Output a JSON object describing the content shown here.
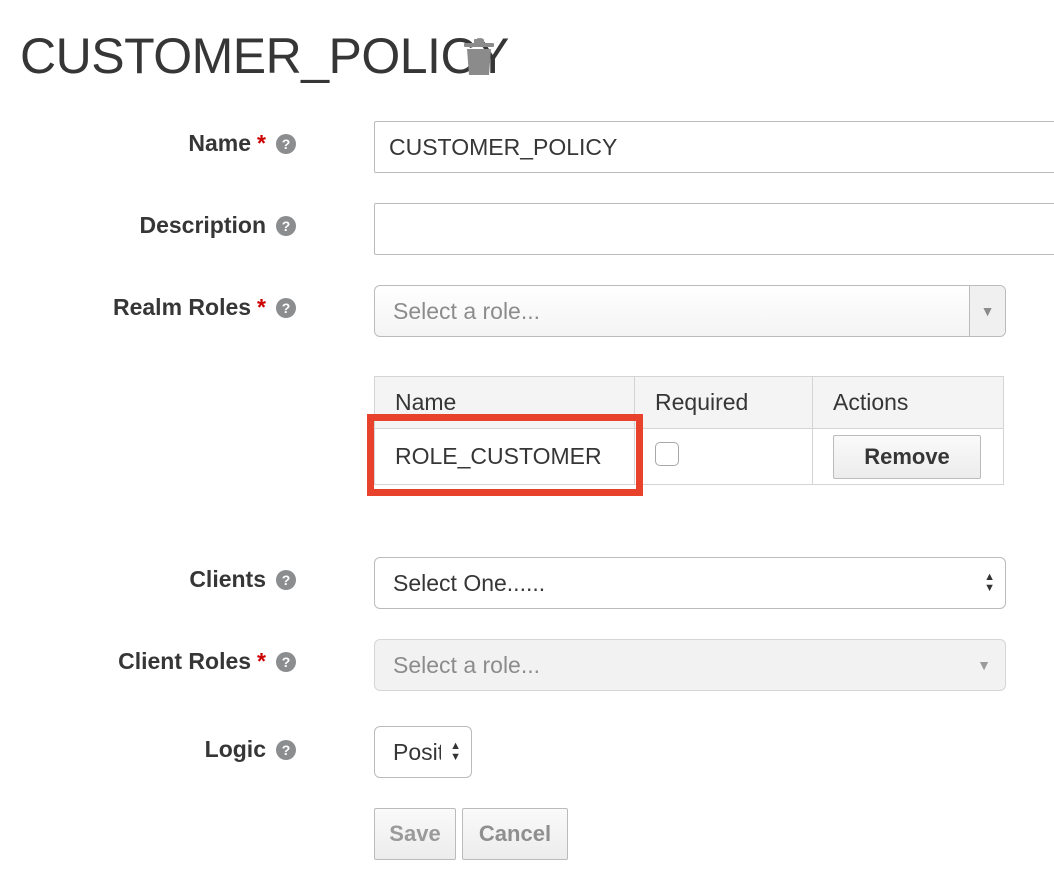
{
  "header": {
    "title": "CUSTOMER_POLICY",
    "delete_icon": "trash-icon"
  },
  "form": {
    "name": {
      "label": "Name",
      "required_mark": "*",
      "value": "CUSTOMER_POLICY"
    },
    "description": {
      "label": "Description",
      "value": ""
    },
    "realm_roles": {
      "label": "Realm Roles",
      "required_mark": "*",
      "placeholder": "Select a role..."
    },
    "roles_table": {
      "columns": [
        "Name",
        "Required",
        "Actions"
      ],
      "rows": [
        {
          "name": "ROLE_CUSTOMER",
          "required": false,
          "action": "Remove"
        }
      ]
    },
    "clients": {
      "label": "Clients",
      "selected": "Select One......"
    },
    "client_roles": {
      "label": "Client Roles",
      "required_mark": "*",
      "placeholder": "Select a role..."
    },
    "logic": {
      "label": "Logic",
      "selected": "Positive",
      "visible_text": "Posit"
    },
    "buttons": {
      "save": "Save",
      "cancel": "Cancel"
    }
  },
  "colors": {
    "highlight": "#e8412c",
    "required": "#cc0000",
    "help_icon": "#8b8d8f"
  }
}
